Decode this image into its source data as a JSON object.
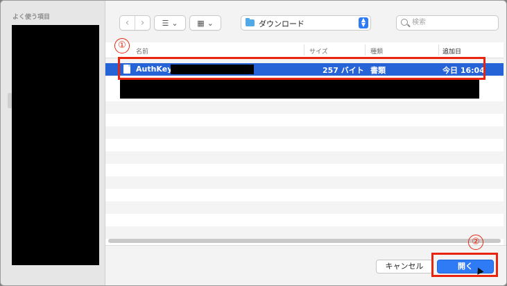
{
  "sidebar": {
    "title": "よく使う項目"
  },
  "toolbar": {
    "location": "ダウンロード",
    "search_placeholder": "検索"
  },
  "columns": {
    "name": "名前",
    "size": "サイズ",
    "kind": "種類",
    "date": "追加日"
  },
  "files": [
    {
      "name": "AuthKey_",
      "size": "257 バイト",
      "kind": "書類",
      "date": "今日 16:04"
    }
  ],
  "footer": {
    "cancel": "キャンセル",
    "open": "開く"
  },
  "annotations": {
    "first": "①",
    "second": "②"
  },
  "colors": {
    "accent": "#2f7bf5",
    "selection": "#2563d6",
    "annotation": "#e8240f"
  }
}
